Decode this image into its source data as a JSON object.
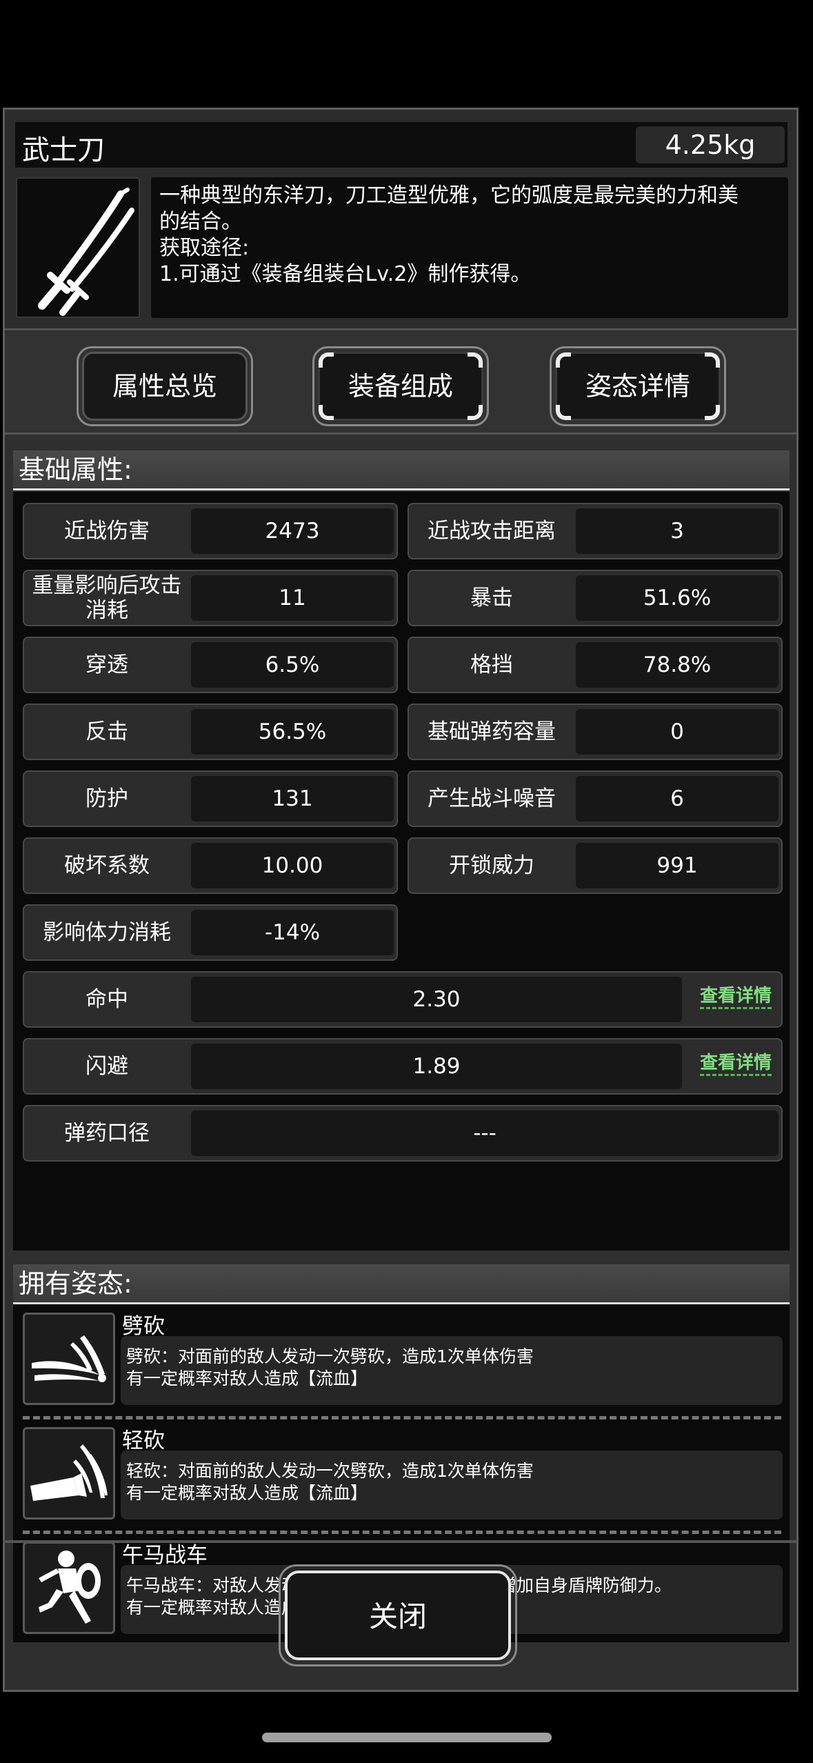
{
  "item": {
    "name": "武士刀",
    "weight": "4.25kg",
    "icon": "katana-icon",
    "description_lines": [
      "一种典型的东洋刀，刀工造型优雅，它的弧度是最完美的力和美",
      "的结合。",
      "获取途径:",
      "1.可通过《装备组装台Lv.2》制作获得。"
    ]
  },
  "tabs": [
    {
      "label": "属性总览"
    },
    {
      "label": "装备组成"
    },
    {
      "label": "姿态详情"
    }
  ],
  "base_section": {
    "title": "基础属性:"
  },
  "stats": [
    {
      "label": "近战伤害",
      "value": "2473"
    },
    {
      "label": "近战攻击距离",
      "value": "3"
    },
    {
      "label": "重量影响后攻击\n消耗",
      "value": "11"
    },
    {
      "label": "暴击",
      "value": "51.6%"
    },
    {
      "label": "穿透",
      "value": "6.5%"
    },
    {
      "label": "格挡",
      "value": "78.8%"
    },
    {
      "label": "反击",
      "value": "56.5%"
    },
    {
      "label": "基础弹药容量",
      "value": "0"
    },
    {
      "label": "防护",
      "value": "131"
    },
    {
      "label": "产生战斗噪音",
      "value": "6"
    },
    {
      "label": "破坏系数",
      "value": "10.00"
    },
    {
      "label": "开锁威力",
      "value": "991"
    },
    {
      "label": "影响体力消耗",
      "value": "-14%"
    }
  ],
  "wide_stats": [
    {
      "label": "命中",
      "value": "2.30",
      "link": "查看详情"
    },
    {
      "label": "闪避",
      "value": "1.89",
      "link": "查看详情"
    },
    {
      "label": "弹药口径",
      "value": "---"
    }
  ],
  "stance_section": {
    "title": "拥有姿态:"
  },
  "stances": [
    {
      "name": "劈砍",
      "icon": "slash-icon",
      "lines": [
        "劈砍：对面前的敌人发动一次劈砍，造成1次单体伤害",
        "有一定概率对敌人造成【流血】"
      ]
    },
    {
      "name": "轻砍",
      "icon": "light-slash-icon",
      "lines": [
        "轻砍：对面前的敌人发动一次劈砍，造成1次单体伤害",
        "有一定概率对敌人造成【流血】"
      ]
    },
    {
      "name": "午马战车",
      "icon": "shield-charge-icon",
      "lines": [
        "午马战车：对敌人发动1次冲锋后执行持盾动作，增加自身盾牌防御力。",
        "有一定概率对敌人造成【流血】,【击退】,【眩晕】"
      ]
    }
  ],
  "close_button": {
    "label": "关闭"
  }
}
